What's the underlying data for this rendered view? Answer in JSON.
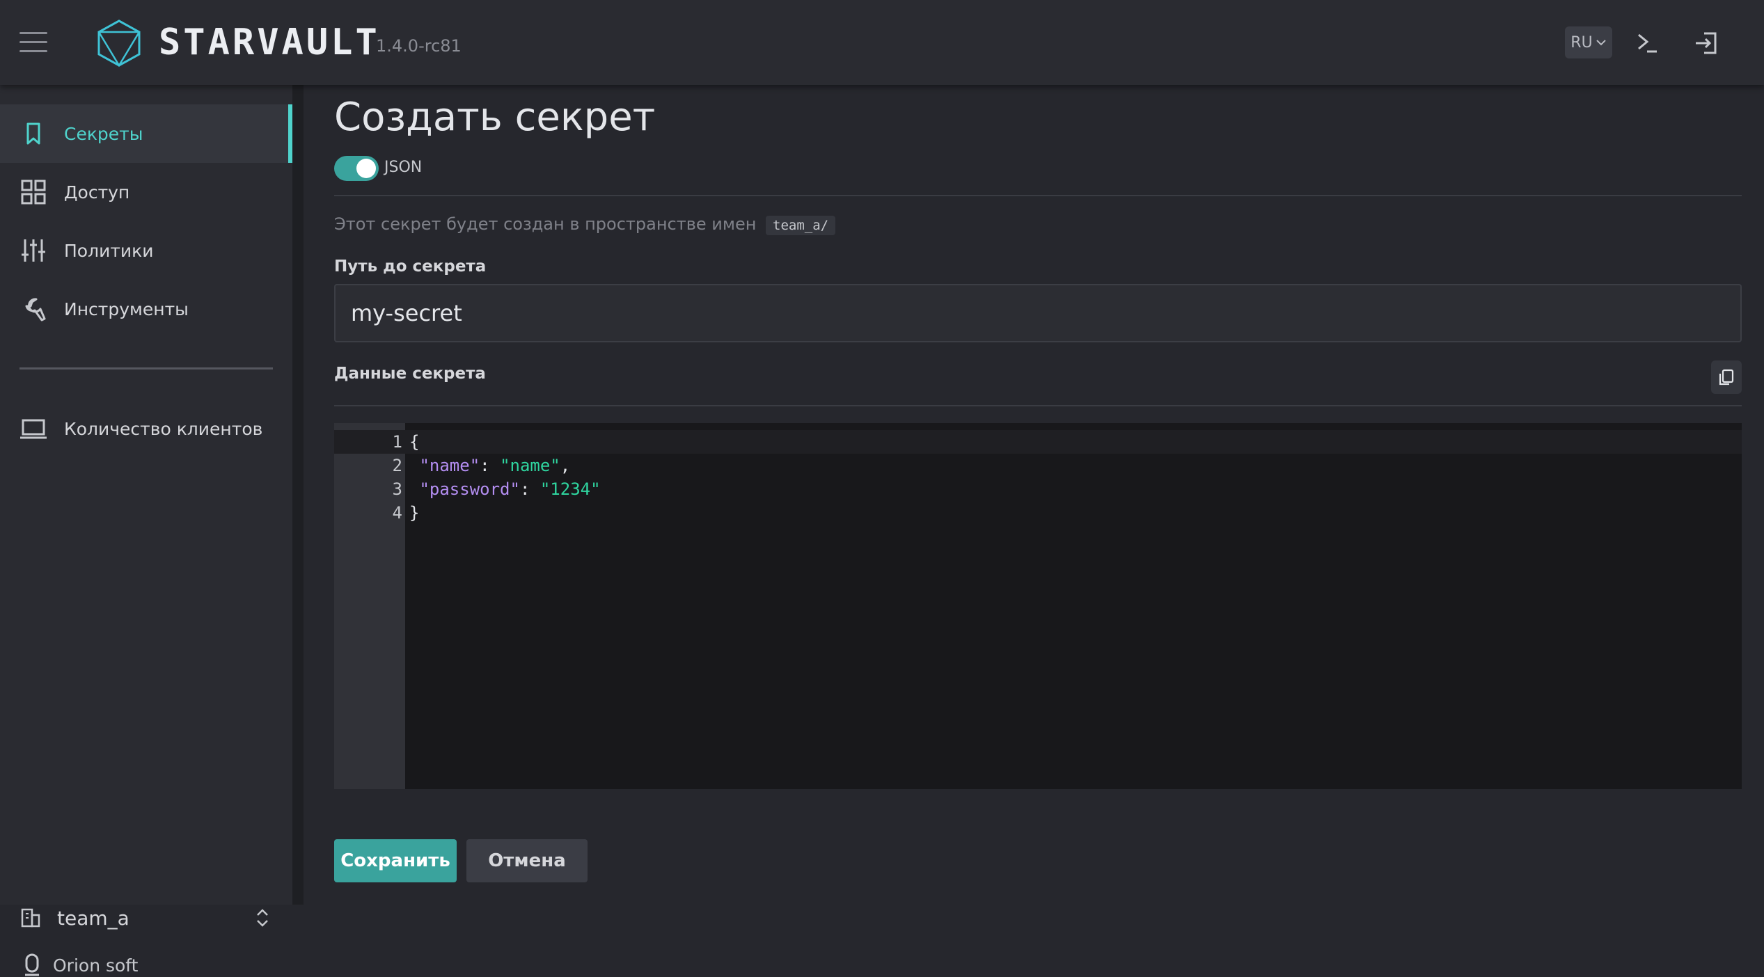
{
  "header": {
    "brand": "STARVAULT",
    "version": "1.4.0-rc81",
    "lang": "RU"
  },
  "sidebar": {
    "items": [
      {
        "label": "Секреты",
        "icon": "bookmark-icon",
        "active": true
      },
      {
        "label": "Доступ",
        "icon": "grid-icon"
      },
      {
        "label": "Политики",
        "icon": "sliders-icon"
      },
      {
        "label": "Инструменты",
        "icon": "wrench-icon"
      }
    ],
    "clients_label": "Количество клиентов",
    "namespace": "team_a",
    "company": "Orion soft"
  },
  "main": {
    "title": "Создать секрет",
    "json_toggle_label": "JSON",
    "namespace_note": "Этот секрет будет создан в пространстве имен",
    "namespace_code": "team_a/",
    "path_label": "Путь до секрета",
    "path_value": "my-secret",
    "data_label": "Данные секрета",
    "editor_lines": [
      "1",
      "2",
      "3",
      "4"
    ],
    "editor": {
      "open": "{",
      "key1": "\"name\"",
      "val1": "\"name\"",
      "key2": "\"password\"",
      "val2": "\"1234\"",
      "close": "}"
    },
    "save_label": "Сохранить",
    "cancel_label": "Отмена"
  },
  "colors": {
    "accent": "#4fd3cc",
    "primary_button": "#3aa39d",
    "json_key": "#b48ef2",
    "json_string": "#2fd6a0"
  }
}
